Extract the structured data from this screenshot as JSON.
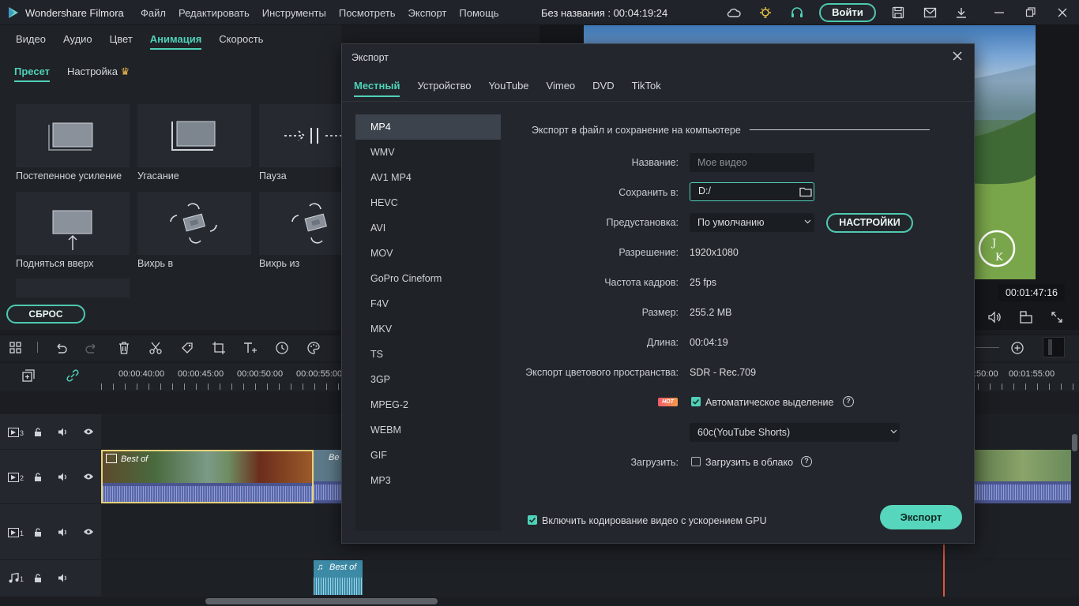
{
  "app": {
    "name": "Wondershare Filmora",
    "project_title": "Без названия : 00:04:19:24",
    "login_label": "Войти"
  },
  "menu": [
    "Файл",
    "Редактировать",
    "Инструменты",
    "Посмотреть",
    "Экспорт",
    "Помощь"
  ],
  "left_panel": {
    "tabs": [
      "Видео",
      "Аудио",
      "Цвет",
      "Анимация",
      "Скорость"
    ],
    "active_tab": "Анимация",
    "sub_tabs": [
      "Пресет",
      "Настройка"
    ],
    "presets": [
      "Постепенное усиление",
      "Угасание",
      "Пауза",
      "Подняться вверх",
      "Вихрь в",
      "Вихрь из"
    ],
    "reset_label": "СБРОС"
  },
  "preview": {
    "timecode": "00:01:47:16"
  },
  "timeline": {
    "ticks": [
      "00:00:40:00",
      "00:00:45:00",
      "00:00:50:00",
      "00:00:55:00",
      ":50:00",
      "00:01:55:00"
    ],
    "tracks": [
      {
        "num": "3",
        "kind": "video"
      },
      {
        "num": "2",
        "kind": "video"
      },
      {
        "num": "1",
        "kind": "video"
      },
      {
        "num": "1",
        "kind": "audio"
      }
    ],
    "clip1_title": "Best of",
    "clip2_title": "Be",
    "audio_clip_title": "Best of"
  },
  "dialog": {
    "title": "Экспорт",
    "tabs": [
      "Местный",
      "Устройство",
      "YouTube",
      "Vimeo",
      "DVD",
      "TikTok"
    ],
    "active_tab": "Местный",
    "formats": [
      "MP4",
      "WMV",
      "AV1 MP4",
      "HEVC",
      "AVI",
      "MOV",
      "GoPro Cineform",
      "F4V",
      "MKV",
      "TS",
      "3GP",
      "MPEG-2",
      "WEBM",
      "GIF",
      "MP3"
    ],
    "selected_format": "MP4",
    "section_title": "Экспорт в файл и сохранение на компьютере",
    "fields": {
      "name_label": "Название:",
      "name_placeholder": "Мое видео",
      "save_label": "Сохранить в:",
      "save_value": "D:/",
      "preset_label": "Предустановка:",
      "preset_value": "По умолчанию",
      "settings_label": "НАСТРОЙКИ",
      "resolution_label": "Разрешение:",
      "resolution_value": "1920x1080",
      "fps_label": "Частота кадров:",
      "fps_value": "25 fps",
      "size_label": "Размер:",
      "size_value": "255.2 MB",
      "length_label": "Длина:",
      "length_value": "00:04:19",
      "colorspace_label": "Экспорт цветового пространства:",
      "colorspace_value": "SDR - Rec.709",
      "hot_badge": "HOT",
      "auto_highlight_label": "Автоматическое выделение",
      "auto_highlight_checked": true,
      "highlight_option": "60c(YouTube Shorts)",
      "upload_label": "Загрузить:",
      "upload_cloud_label": "Загрузить в облако",
      "upload_checked": false
    },
    "gpu_label": "Включить кодирование видео с ускорением GPU",
    "gpu_checked": true,
    "export_label": "Экспорт"
  },
  "colors": {
    "accent": "#4fd1b8",
    "background": "#1b1d22",
    "dialog": "#23262c",
    "playhead": "#e0563b"
  }
}
